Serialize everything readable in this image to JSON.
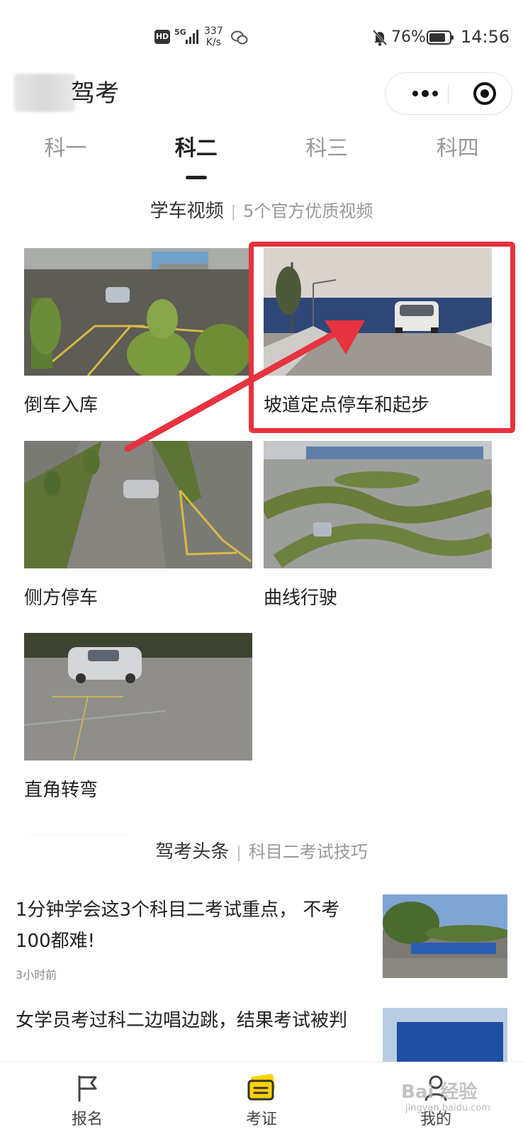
{
  "status_bar": {
    "hd": "HD",
    "network": "5G",
    "speed_value": "337",
    "speed_unit": "K/s",
    "battery": "76%",
    "time": "14:56"
  },
  "header": {
    "title": "驾考"
  },
  "tabs": [
    {
      "label": "科一",
      "active": false
    },
    {
      "label": "科二",
      "active": true
    },
    {
      "label": "科三",
      "active": false
    },
    {
      "label": "科四",
      "active": false
    }
  ],
  "video_section": {
    "title": "学车视频",
    "separator": "|",
    "subtitle": "5个官方优质视频",
    "videos": [
      {
        "label": "倒车入库"
      },
      {
        "label": "坡道定点停车和起步"
      },
      {
        "label": "侧方停车"
      },
      {
        "label": "曲线行驶"
      },
      {
        "label": "直角转弯"
      }
    ]
  },
  "news_section": {
    "title": "驾考头条",
    "separator": "|",
    "subtitle": "科目二考试技巧",
    "items": [
      {
        "title": "1分钟学会这3个科目二考试重点， 不考100都难!",
        "time": "3小时前"
      },
      {
        "title": "女学员考过科二边唱边跳，结果考试被判",
        "time": ""
      }
    ]
  },
  "bottom_nav": [
    {
      "label": "报名",
      "icon": "flag-icon",
      "active": false
    },
    {
      "label": "考证",
      "icon": "license-card-icon",
      "active": true
    },
    {
      "label": "我的",
      "icon": "user-icon",
      "active": false
    }
  ],
  "watermark": {
    "text": "Bai 经验",
    "sub": "jingyan.baidu.com"
  },
  "colors": {
    "accent": "#ffd200",
    "highlight": "#e6333f",
    "text": "#222222",
    "muted": "#999999"
  }
}
